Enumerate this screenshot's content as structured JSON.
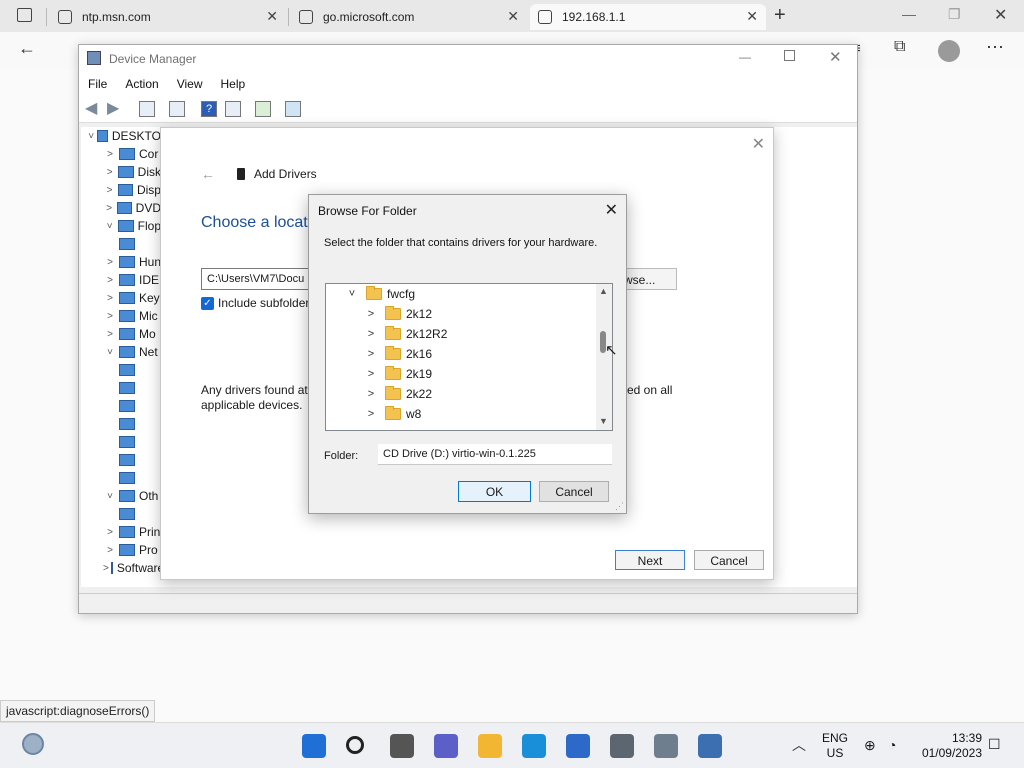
{
  "browser": {
    "tabs": [
      {
        "title": "ntp.msn.com"
      },
      {
        "title": "go.microsoft.com"
      },
      {
        "title": "192.168.1.1"
      }
    ],
    "status_url": "javascript:diagnoseErrors()"
  },
  "device_manager": {
    "title": "Device Manager",
    "menu": [
      "File",
      "Action",
      "View",
      "Help"
    ],
    "tree": [
      {
        "chev": "˅",
        "label": "DESKTO"
      },
      {
        "chev": ">",
        "label": "Cor"
      },
      {
        "chev": ">",
        "label": "Disk"
      },
      {
        "chev": ">",
        "label": "Disp"
      },
      {
        "chev": ">",
        "label": "DVD"
      },
      {
        "chev": "˅",
        "label": "Flop"
      },
      {
        "chev": "",
        "label": ""
      },
      {
        "chev": ">",
        "label": "Hun"
      },
      {
        "chev": ">",
        "label": "IDE"
      },
      {
        "chev": ">",
        "label": "Key"
      },
      {
        "chev": ">",
        "label": "Mic"
      },
      {
        "chev": ">",
        "label": "Mo"
      },
      {
        "chev": "˅",
        "label": "Net"
      },
      {
        "chev": "",
        "label": ""
      },
      {
        "chev": "",
        "label": ""
      },
      {
        "chev": "",
        "label": ""
      },
      {
        "chev": "",
        "label": ""
      },
      {
        "chev": "",
        "label": ""
      },
      {
        "chev": "",
        "label": ""
      },
      {
        "chev": "",
        "label": ""
      },
      {
        "chev": "˅",
        "label": "Oth"
      },
      {
        "chev": "",
        "label": ""
      },
      {
        "chev": ">",
        "label": "Prin"
      },
      {
        "chev": ">",
        "label": "Pro"
      },
      {
        "chev": ">",
        "label": "Software devices"
      }
    ]
  },
  "wizard": {
    "header": "Add Drivers",
    "heading": "Choose a locatio",
    "path_value": "C:\\Users\\VM7\\Docu",
    "browse_label": "wse...",
    "checkbox_label": "Include subfolder",
    "info_text": "Any drivers found at",
    "info_text_2": "applicable devices.",
    "info_text_right": "ed on all",
    "next_label": "Next",
    "cancel_label": "Cancel"
  },
  "browse_dialog": {
    "title": "Browse For Folder",
    "description": "Select the folder that contains drivers for your hardware.",
    "parent_folder": "fwcfg",
    "folders": [
      "2k12",
      "2k12R2",
      "2k16",
      "2k19",
      "2k22",
      "w8"
    ],
    "folder_label": "Folder:",
    "folder_value": "CD Drive (D:) virtio-win-0.1.225",
    "ok_label": "OK",
    "cancel_label": "Cancel"
  },
  "taskbar": {
    "lang_top": "ENG",
    "lang_bottom": "US",
    "time": "13:39",
    "date": "01/09/2023",
    "icons": [
      "start-icon",
      "search-icon",
      "task-view-icon",
      "chat-icon",
      "file-explorer-icon",
      "edge-icon",
      "store-icon",
      "settings-icon",
      "device-manager-icon",
      "remote-desktop-icon"
    ]
  }
}
